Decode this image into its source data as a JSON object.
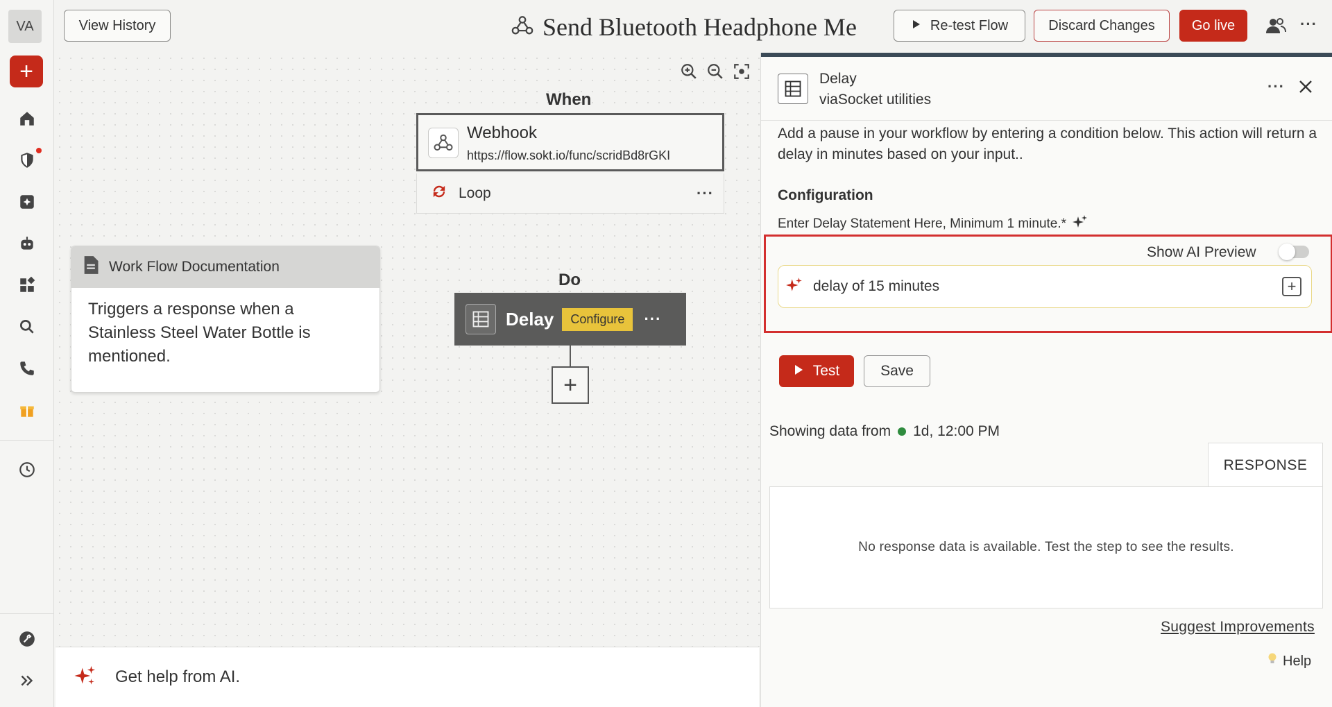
{
  "rail": {
    "avatar": "VA",
    "add_label": "+",
    "items": [
      "home-icon",
      "shield-icon",
      "plus-square-icon",
      "bot-icon",
      "apps-icon",
      "search-icon",
      "phone-icon",
      "gift-icon",
      "history-icon",
      "tool-icon",
      "expand-icon"
    ]
  },
  "topbar": {
    "view_history": "View History",
    "flow_title": "Send Bluetooth Headphone Me",
    "retest": "Re-test Flow",
    "discard": "Discard Changes",
    "go_live": "Go live"
  },
  "canvas": {
    "when_label": "When",
    "webhook": {
      "name": "Webhook",
      "url": "https://flow.sokt.io/func/scridBd8rGKI"
    },
    "loop_label": "Loop",
    "do_label": "Do",
    "delay_node": {
      "name": "Delay",
      "configure": "Configure"
    },
    "doc": {
      "title": "Work Flow Documentation",
      "body": "Triggers a response when a Stainless Steel Water Bottle is mentioned."
    },
    "ai_help": "Get help from AI."
  },
  "panel": {
    "title": "Delay",
    "subtitle": "viaSocket utilities",
    "description": "Add a pause in your workflow by entering a condition below. This action will return a delay in minutes based on your input..",
    "config_title": "Configuration",
    "config_label": "Enter Delay Statement Here, Minimum 1 minute.*",
    "ai_preview_label": "Show AI Preview",
    "ai_preview_on": false,
    "input_value": "delay of 15 minutes",
    "test_label": "Test",
    "save_label": "Save",
    "showing_prefix": "Showing data from",
    "showing_time": "1d, 12:00 PM",
    "response_tab": "RESPONSE",
    "no_response": "No response data is available. Test the step to see the results.",
    "suggest": "Suggest Improvements",
    "help": "Help"
  },
  "colors": {
    "brand_red": "#c52a1a",
    "status_green": "#2e8b3e",
    "configure_yellow": "#e8c33b"
  }
}
